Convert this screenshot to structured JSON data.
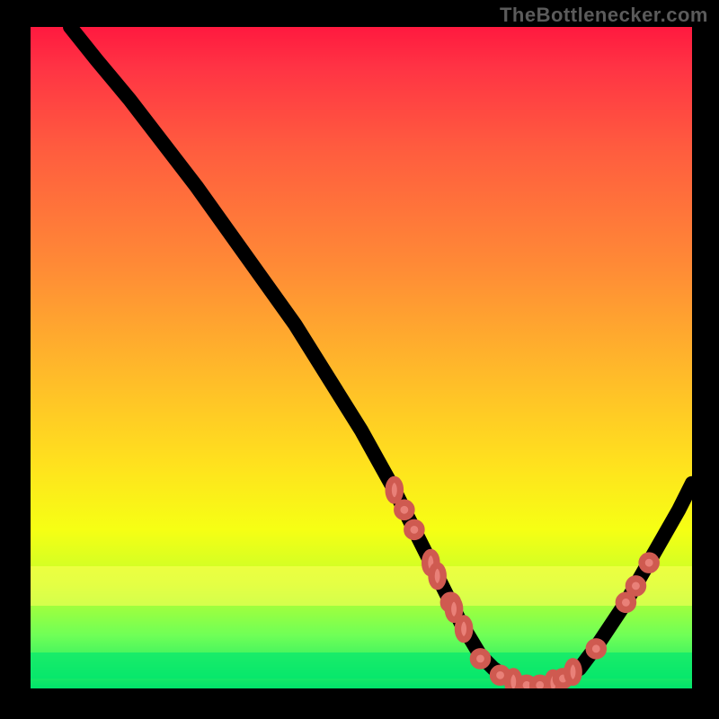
{
  "watermark": "TheBottlenecker.com",
  "colors": {
    "gradient_top": "#ff193f",
    "gradient_bottom": "#00e36b",
    "dot_fill": "#e98078",
    "dot_stroke": "#cf5a50",
    "curve": "#000000",
    "frame": "#000000"
  },
  "chart_data": {
    "type": "line",
    "title": "",
    "xlabel": "",
    "ylabel": "",
    "xlim": [
      0,
      100
    ],
    "ylim": [
      0,
      100
    ],
    "curve": {
      "x": [
        6,
        10,
        15,
        20,
        25,
        30,
        35,
        40,
        45,
        50,
        55,
        58,
        60,
        63,
        65,
        68,
        70,
        73,
        76,
        78,
        80,
        83,
        86,
        90,
        94,
        98,
        100
      ],
      "y": [
        100,
        95,
        89,
        82.5,
        76,
        69,
        62,
        55,
        47,
        39,
        30,
        24,
        20,
        14,
        10,
        5,
        3,
        1,
        0.5,
        0.5,
        1,
        3,
        7,
        13,
        20,
        27,
        31
      ]
    },
    "markers": {
      "comment": "Approximate x,y positions of the salmon marker dots along the curve (0-100 scale)",
      "points": [
        {
          "x": 55.0,
          "y": 30.0,
          "shape": "oval"
        },
        {
          "x": 56.5,
          "y": 27.0,
          "shape": "round"
        },
        {
          "x": 58.0,
          "y": 24.0,
          "shape": "round"
        },
        {
          "x": 60.5,
          "y": 19.0,
          "shape": "oval"
        },
        {
          "x": 61.5,
          "y": 17.0,
          "shape": "oval"
        },
        {
          "x": 63.5,
          "y": 13.0,
          "shape": "round"
        },
        {
          "x": 64.0,
          "y": 12.0,
          "shape": "oval"
        },
        {
          "x": 65.5,
          "y": 9.0,
          "shape": "oval"
        },
        {
          "x": 68.0,
          "y": 4.5,
          "shape": "round"
        },
        {
          "x": 71.0,
          "y": 2.0,
          "shape": "round"
        },
        {
          "x": 73.0,
          "y": 1.0,
          "shape": "oval"
        },
        {
          "x": 75.0,
          "y": 0.5,
          "shape": "round"
        },
        {
          "x": 77.0,
          "y": 0.5,
          "shape": "round"
        },
        {
          "x": 79.0,
          "y": 0.8,
          "shape": "oval"
        },
        {
          "x": 80.5,
          "y": 1.5,
          "shape": "round"
        },
        {
          "x": 82.0,
          "y": 2.5,
          "shape": "oval"
        },
        {
          "x": 85.5,
          "y": 6.0,
          "shape": "round"
        },
        {
          "x": 90.0,
          "y": 13.0,
          "shape": "round"
        },
        {
          "x": 91.5,
          "y": 15.5,
          "shape": "round"
        },
        {
          "x": 93.5,
          "y": 19.0,
          "shape": "round"
        }
      ]
    }
  }
}
